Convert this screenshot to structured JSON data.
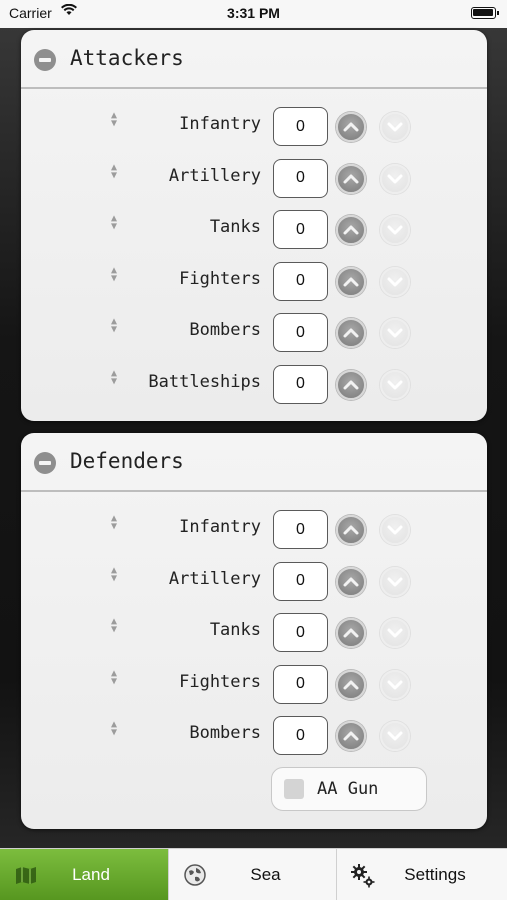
{
  "status_bar": {
    "carrier": "Carrier",
    "time": "3:31 PM"
  },
  "attackers": {
    "title": "Attackers",
    "units": [
      {
        "label": "Infantry",
        "count": "0"
      },
      {
        "label": "Artillery",
        "count": "0"
      },
      {
        "label": "Tanks",
        "count": "0"
      },
      {
        "label": "Fighters",
        "count": "0"
      },
      {
        "label": "Bombers",
        "count": "0"
      },
      {
        "label": "Battleships",
        "count": "0"
      }
    ]
  },
  "defenders": {
    "title": "Defenders",
    "units": [
      {
        "label": "Infantry",
        "count": "0"
      },
      {
        "label": "Artillery",
        "count": "0"
      },
      {
        "label": "Tanks",
        "count": "0"
      },
      {
        "label": "Fighters",
        "count": "0"
      },
      {
        "label": "Bombers",
        "count": "0"
      }
    ],
    "aa_gun": {
      "label": "AA Gun",
      "checked": false
    }
  },
  "tabs": [
    {
      "label": "Land",
      "icon": "map-icon",
      "selected": true
    },
    {
      "label": "Sea",
      "icon": "globe-icon",
      "selected": false
    },
    {
      "label": "Settings",
      "icon": "gears-icon",
      "selected": false
    }
  ],
  "colors": {
    "selected_tab": "#6aaa2e",
    "panel_background": "#efefef"
  }
}
